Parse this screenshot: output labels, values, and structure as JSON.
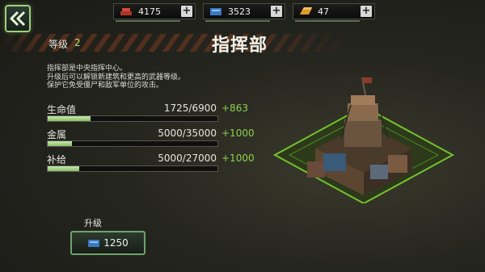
{
  "header": {
    "resources": [
      {
        "icon": "steel-icon",
        "value": "4175"
      },
      {
        "icon": "supply-crate-icon",
        "value": "3523"
      },
      {
        "icon": "gold-bar-icon",
        "value": "47"
      }
    ],
    "plus_label": "+"
  },
  "building": {
    "level_label": "等级",
    "level": "2",
    "title": "指挥部",
    "description": [
      "指挥部是中央指挥中心。",
      "升级后可以解锁新建筑和更高的武器等级。",
      "保护它免受僵尸和敌军单位的攻击。"
    ]
  },
  "stats": [
    {
      "label": "生命值",
      "value": "1725/6900",
      "bonus": "+863",
      "progress": 0.25
    },
    {
      "label": "金属",
      "value": "5000/35000",
      "bonus": "+1000",
      "progress": 0.143
    },
    {
      "label": "补给",
      "value": "5000/27000",
      "bonus": "+1000",
      "progress": 0.185
    }
  ],
  "upgrade": {
    "label": "升级",
    "cost": "1250",
    "cost_icon": "supply-crate-icon"
  },
  "colors": {
    "accent_green": "#8ed14e",
    "bar_fill": "#a8d88a",
    "background": "#262620"
  }
}
